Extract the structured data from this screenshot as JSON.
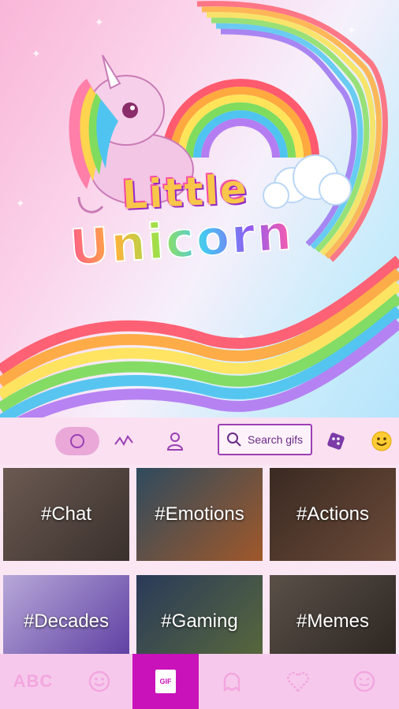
{
  "hero": {
    "title_line1": "Little",
    "title_line2": "Unicorn"
  },
  "toolbar": {
    "search_placeholder": "Search gifs"
  },
  "categories": [
    {
      "label": "#Chat"
    },
    {
      "label": "#Emotions"
    },
    {
      "label": "#Actions"
    },
    {
      "label": "#Decades"
    },
    {
      "label": "#Gaming"
    },
    {
      "label": "#Memes"
    }
  ],
  "tabbar": {
    "abc_label": "ABC",
    "gif_label": "GIF",
    "active_tab": "gif"
  },
  "colors": {
    "accent": "#c912b9",
    "search_border": "#9b3fb4"
  }
}
